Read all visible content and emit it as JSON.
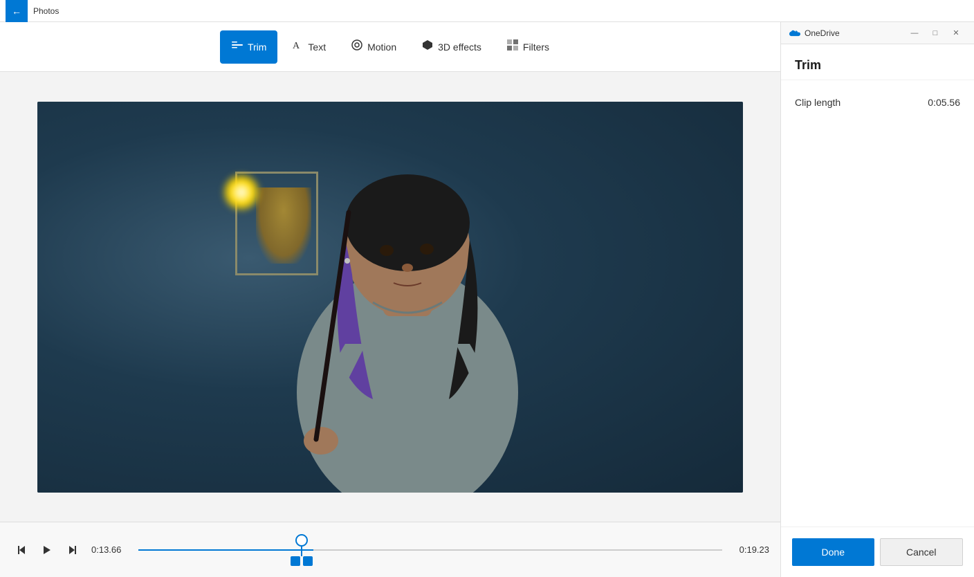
{
  "titleBar": {
    "appName": "Photos",
    "backLabel": "←"
  },
  "toolbar": {
    "buttons": [
      {
        "id": "trim",
        "label": "Trim",
        "icon": "⊟",
        "active": true
      },
      {
        "id": "text",
        "label": "Text",
        "icon": "A",
        "active": false
      },
      {
        "id": "motion",
        "label": "Motion",
        "icon": "◎",
        "active": false
      },
      {
        "id": "3deffects",
        "label": "3D effects",
        "icon": "✦",
        "active": false
      },
      {
        "id": "filters",
        "label": "Filters",
        "icon": "▦",
        "active": false
      }
    ]
  },
  "timeline": {
    "currentTime": "0:13.66",
    "endTime": "0:19.23"
  },
  "rightPanel": {
    "onedrive": "OneDrive",
    "title": "Trim",
    "clipLengthLabel": "Clip length",
    "clipLengthValue": "0:05.56",
    "doneLabel": "Done",
    "cancelLabel": "Cancel"
  }
}
